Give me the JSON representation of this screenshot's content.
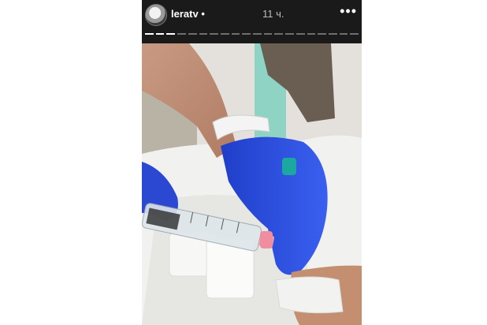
{
  "story": {
    "username": "leratv",
    "dot": "•",
    "time": "11 ч.",
    "more_label": "•••",
    "segments_total": 20,
    "segments_done": 3
  },
  "colors": {
    "topbar": "#1a1a1a",
    "glove": "#2d4fd8",
    "wristband": "#f4f4f4",
    "bed_sheet": "#eeeeee"
  },
  "icons": {
    "avatar": "avatar-photo",
    "more": "more-dots-icon"
  }
}
